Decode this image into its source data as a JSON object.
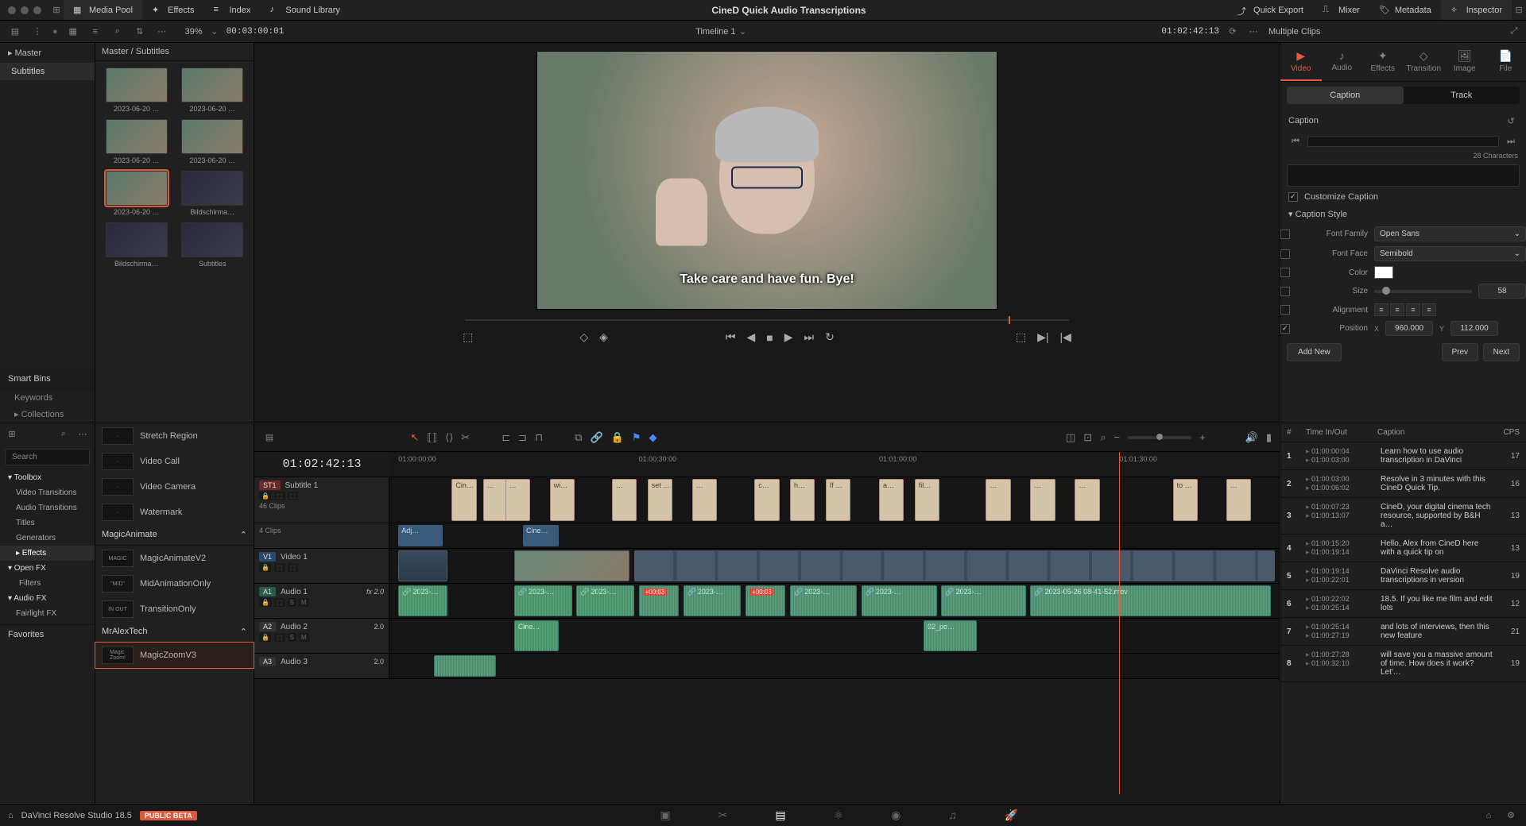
{
  "title": "CineD Quick Audio Transcriptions",
  "topbar": {
    "left": [
      {
        "icon": "media-pool-icon",
        "label": "Media Pool"
      },
      {
        "icon": "effects-icon",
        "label": "Effects"
      },
      {
        "icon": "index-icon",
        "label": "Index"
      },
      {
        "icon": "sound-icon",
        "label": "Sound Library"
      }
    ],
    "right": [
      {
        "icon": "export-icon",
        "label": "Quick Export"
      },
      {
        "icon": "mixer-icon",
        "label": "Mixer"
      },
      {
        "icon": "meta-icon",
        "label": "Metadata"
      },
      {
        "icon": "inspector-icon",
        "label": "Inspector"
      }
    ]
  },
  "secbar": {
    "zoom": "39%",
    "src_tc": "00:03:00:01",
    "timeline_name": "Timeline 1",
    "timeline_tc": "01:02:42:13"
  },
  "leftcol": {
    "master": "Master",
    "items": [
      "Subtitles"
    ],
    "smart": "Smart Bins",
    "smart_items": [
      "Keywords",
      "Collections"
    ]
  },
  "media": {
    "breadcrumb": "Master / Subtitles",
    "thumbs": [
      {
        "label": "2023-06-20 …",
        "kind": "live"
      },
      {
        "label": "2023-06-20 …",
        "kind": "live"
      },
      {
        "label": "2023-06-20 …",
        "kind": "live"
      },
      {
        "label": "2023-06-20 …",
        "kind": "live"
      },
      {
        "label": "2023-06-20 …",
        "kind": "live",
        "sel": true
      },
      {
        "label": "Bildschirma…",
        "kind": "dark"
      },
      {
        "label": "Bildschirma…",
        "kind": "dark"
      },
      {
        "label": "Subtitles",
        "kind": "dark"
      }
    ]
  },
  "viewer": {
    "subtitle_text": "Take care and have fun. Bye!"
  },
  "inspector": {
    "header": "Multiple Clips",
    "tabs": [
      "Video",
      "Audio",
      "Effects",
      "Transition",
      "Image",
      "File"
    ],
    "active_tab": 0,
    "subtabs": [
      "Caption",
      "Track"
    ],
    "active_sub": 0,
    "section_caption": "Caption",
    "characters": "28 Characters",
    "customize": "Customize Caption",
    "style_hdr": "Caption Style",
    "font_family_lbl": "Font Family",
    "font_family": "Open Sans",
    "font_face_lbl": "Font Face",
    "font_face": "Semibold",
    "color_lbl": "Color",
    "size_lbl": "Size",
    "size": "58",
    "align_lbl": "Alignment",
    "pos_lbl": "Position",
    "pos_x_lbl": "X",
    "pos_x": "960.000",
    "pos_y_lbl": "Y",
    "pos_y": "112.000",
    "add_new": "Add New",
    "prev": "Prev",
    "next": "Next"
  },
  "fxpanel": {
    "favorites": "Favorites",
    "search_placeholder": "Search",
    "groups": [
      {
        "label": "Toolbox",
        "bold": true
      },
      {
        "label": "Video Transitions"
      },
      {
        "label": "Audio Transitions"
      },
      {
        "label": "Titles"
      },
      {
        "label": "Generators"
      },
      {
        "label": "Effects",
        "active": true,
        "expand": true
      },
      {
        "label": "Open FX",
        "bold": true
      },
      {
        "label": "Filters",
        "indent": true
      },
      {
        "label": "Audio FX",
        "bold": true
      },
      {
        "label": "Fairlight FX"
      }
    ]
  },
  "fxlist": {
    "rows1": [
      {
        "label": "Stretch Region"
      },
      {
        "label": "Video Call"
      },
      {
        "label": "Video Camera"
      },
      {
        "label": "Watermark"
      }
    ],
    "group2": "MagicAnimate",
    "rows2": [
      {
        "thumb": "MAGIC",
        "label": "MagicAnimateV2"
      },
      {
        "thumb": "\"MID\"",
        "label": "MidAnimationOnly"
      },
      {
        "thumb": "IN OUT",
        "label": "TransitionOnly"
      }
    ],
    "group3": "MrAlexTech",
    "rows3": [
      {
        "thumb": "Magic\\nZoom!",
        "label": "MagicZoomV3",
        "sel": true
      }
    ]
  },
  "timeline": {
    "tc": "01:02:42:13",
    "ticks": [
      "01:00:00:00",
      "01:00:30:00",
      "01:01:00:00",
      "01:01:30:00"
    ],
    "st1": {
      "tag": "ST1",
      "name": "Subtitle 1",
      "clips": "46 Clips"
    },
    "grp": {
      "clips": "4 Clips"
    },
    "v1": {
      "tag": "V1",
      "name": "Video 1"
    },
    "a1": {
      "tag": "A1",
      "name": "Audio 1",
      "fx": "fx 2.0"
    },
    "a2": {
      "tag": "A2",
      "name": "Audio 2",
      "lvl": "2.0"
    },
    "a3": {
      "tag": "A3",
      "name": "Audio 3",
      "lvl": "2.0"
    },
    "sub_clips": [
      "Cin…",
      "…",
      "…",
      "wi…",
      "…",
      "set …",
      "…",
      "c…",
      "h…",
      "If …",
      "a…",
      "fil…",
      "…",
      "…",
      "…",
      "to …",
      "…"
    ],
    "adj_label": "Adj…",
    "cine_label": "Cine…",
    "a1_clips": [
      "2023-…",
      "2023-…",
      "2023-…",
      "+00:03",
      "2023-…",
      "+00:03",
      "2023-…",
      "2023-…",
      "2023-…",
      "2023-05-26 08-41-52.mov"
    ],
    "a2_clip": "Cine…",
    "a2_clip2": "02_po…"
  },
  "captions": {
    "cols": {
      "n": "#",
      "t": "Time In/Out",
      "c": "Caption",
      "cps": "CPS"
    },
    "rows": [
      {
        "n": "1",
        "in": "01:00:00:04",
        "out": "01:00:03:00",
        "text": "Learn how to use audio transcription in DaVinci",
        "cps": "17"
      },
      {
        "n": "2",
        "in": "01:00:03:00",
        "out": "01:00:06:02",
        "text": "Resolve in 3 minutes with this CineD Quick Tip.",
        "cps": "16"
      },
      {
        "n": "3",
        "in": "01:00:07:23",
        "out": "01:00:13:07",
        "text": "CineD, your digital cinema tech resource, supported by B&H a…",
        "cps": "13"
      },
      {
        "n": "4",
        "in": "01:00:15:20",
        "out": "01:00:19:14",
        "text": "Hello, Alex from CineD here with a quick tip on",
        "cps": "13"
      },
      {
        "n": "5",
        "in": "01:00:19:14",
        "out": "01:00:22:01",
        "text": "DaVinci Resolve audio transcriptions in version",
        "cps": "19"
      },
      {
        "n": "6",
        "in": "01:00:22:02",
        "out": "01:00:25:14",
        "text": "18.5. If you like me film and edit lots",
        "cps": "12"
      },
      {
        "n": "7",
        "in": "01:00:25:14",
        "out": "01:00:27:19",
        "text": "and lots of interviews, then this new feature",
        "cps": "21"
      },
      {
        "n": "8",
        "in": "01:00:27:28",
        "out": "01:00:32:10",
        "text": "will save you a massive amount of time. How does it work? Let'…",
        "cps": "19"
      }
    ]
  },
  "bottom": {
    "app": "DaVinci Resolve Studio 18.5",
    "beta": "PUBLIC BETA"
  }
}
